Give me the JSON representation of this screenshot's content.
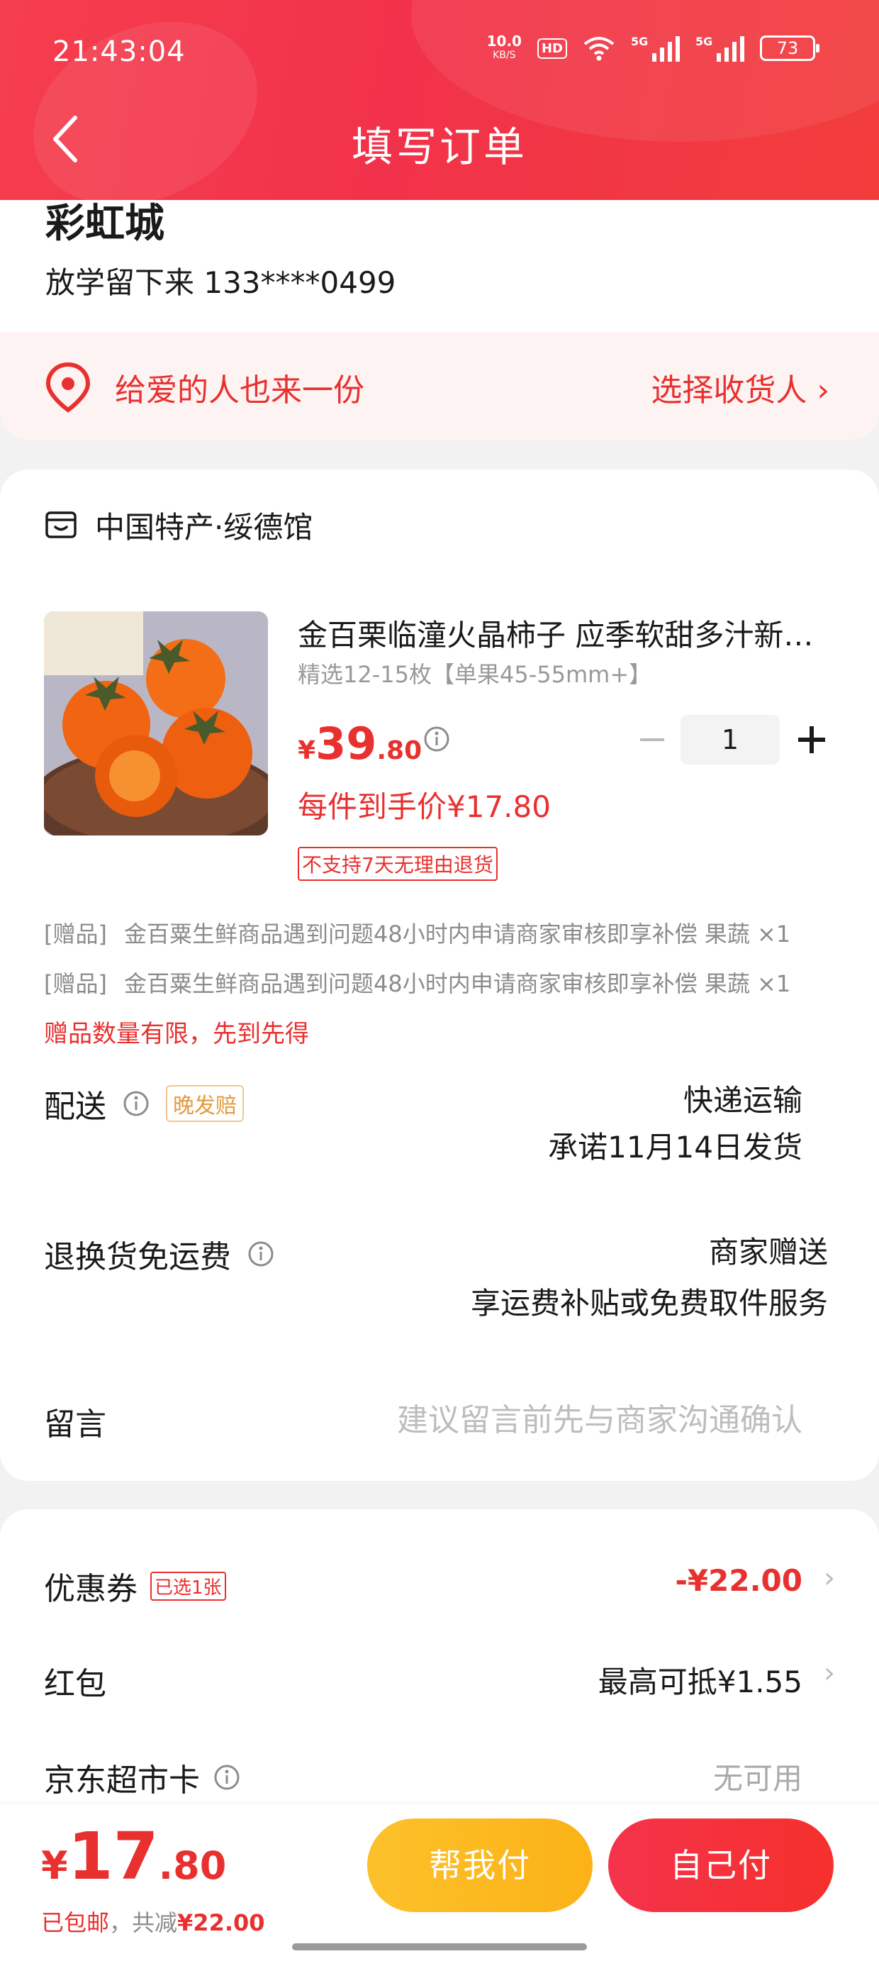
{
  "status_bar": {
    "time": "21:43:04",
    "net_speed": "10.0",
    "net_unit": "KB/S",
    "hd": "HD",
    "signal1": "5G",
    "signal2": "5G",
    "battery": "73"
  },
  "header": {
    "title": "填写订单",
    "back_icon": "chevron-left-icon"
  },
  "address": {
    "title": "彩虹城",
    "person": "放学留下来  133****0499",
    "gift_text": "给爱的人也来一份",
    "gift_action": "选择收货人",
    "gift_chevron": "›"
  },
  "shop": {
    "name": "中国特产·绥德馆"
  },
  "product": {
    "name": "金百栗临潼火晶柿子 应季软甜多汁新鲜水果",
    "spec": "精选12-15枚【单果45-55mm+】",
    "price_yen": "¥",
    "price_int": "39",
    "price_dec": ".80",
    "quantity": "1",
    "unit_price": "每件到手价¥17.80",
    "no_return": "不支持7天无理由退货"
  },
  "gifts": [
    {
      "tag": "[赠品]",
      "text": "金百粟生鲜商品遇到问题48小时内申请商家审核即享补偿 果蔬 ×1"
    },
    {
      "tag": "[赠品]",
      "text": "金百粟生鲜商品遇到问题48小时内申请商家审核即享补偿 果蔬 ×1"
    }
  ],
  "gift_limit": "赠品数量有限，先到先得",
  "delivery": {
    "label": "配送",
    "badge": "晚发赔",
    "method": "快递运输",
    "promise": "承诺11月14日发货"
  },
  "return_shipping": {
    "label": "退换货免运费",
    "value": "商家赠送",
    "desc": "享运费补贴或免费取件服务"
  },
  "memo": {
    "label": "留言",
    "placeholder": "建议留言前先与商家沟通确认"
  },
  "coupons": {
    "coupon_label": "优惠券",
    "coupon_badge": "已选1张",
    "coupon_value": "-¥22.00",
    "redpacket_label": "红包",
    "redpacket_value": "最高可抵¥1.55",
    "card_label": "京东超市卡",
    "card_value": "无可用",
    "chevron": "›"
  },
  "footer": {
    "total_yen": "¥",
    "total_int": "17",
    "total_dec": ".80",
    "shipping": "已包邮",
    "saved_prefix": "，共减",
    "saved_amount": "¥22.00",
    "help_pay": "帮我付",
    "self_pay": "自己付"
  },
  "colors": {
    "brand_red": "#e8312f",
    "header_red": "#f2324a",
    "help_yellow": "#fbb216"
  }
}
